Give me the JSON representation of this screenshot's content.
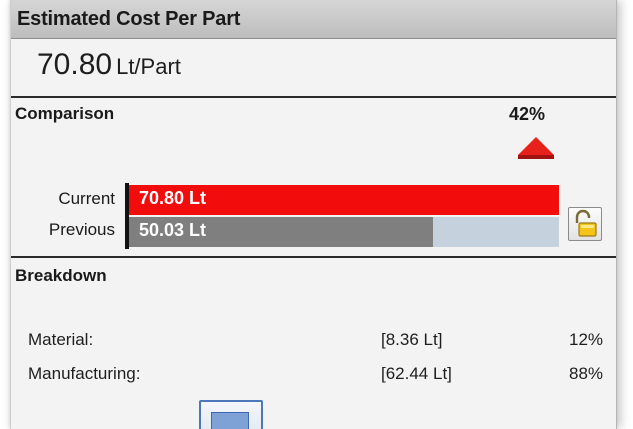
{
  "header": {
    "title": "Estimated Cost Per Part"
  },
  "cost": {
    "value": "70.80",
    "unit": "Lt/Part"
  },
  "comparison": {
    "label": "Comparison",
    "change_percent": "42%",
    "trend": "up",
    "bars": [
      {
        "label": "Current",
        "text": "70.80 Lt",
        "value": 70.8,
        "color": "#f20c0c"
      },
      {
        "label": "Previous",
        "text": "50.03 Lt",
        "value": 50.03,
        "color": "#7f7f7f"
      }
    ],
    "track_color": "#c5d2de",
    "lock_icon": "unlocked-padlock-icon"
  },
  "breakdown": {
    "label": "Breakdown",
    "rows": [
      {
        "name": "Material:",
        "amount": "[8.36 Lt]",
        "share": "12%"
      },
      {
        "name": "Manufacturing:",
        "amount": "[62.44 Lt]",
        "share": "88%"
      }
    ]
  },
  "colors": {
    "accent_red": "#e8201a",
    "header_bg": "#c8c8c8"
  }
}
